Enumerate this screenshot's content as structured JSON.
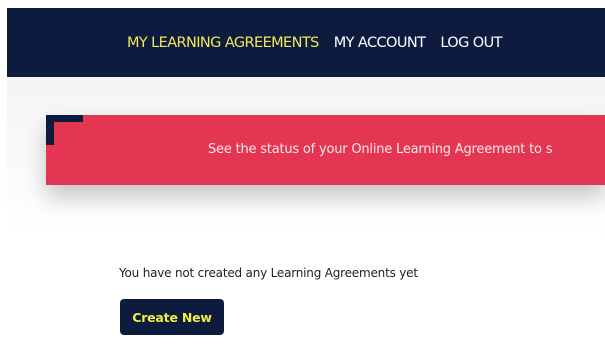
{
  "nav": {
    "items": [
      {
        "label": "MY LEARNING AGREEMENTS",
        "active": true
      },
      {
        "label": "MY ACCOUNT",
        "active": false
      },
      {
        "label": "LOG OUT",
        "active": false
      }
    ]
  },
  "banner": {
    "text": "See the status of your Online Learning Agreement to s"
  },
  "main": {
    "empty_message": "You have not created any Learning Agreements yet",
    "create_label": "Create New"
  },
  "colors": {
    "navy": "#0d1b3e",
    "banner_red": "#e43652",
    "accent_yellow": "#f5ee3b"
  }
}
